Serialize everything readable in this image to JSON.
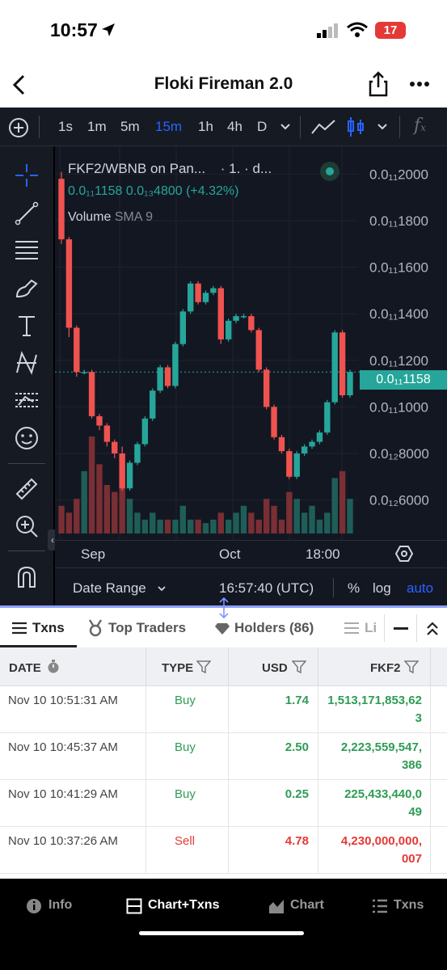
{
  "status": {
    "time": "10:57",
    "battery": "17"
  },
  "nav": {
    "title": "Floki Fireman 2.0"
  },
  "toolbar": {
    "timeframes": [
      "1s",
      "1m",
      "5m",
      "15m",
      "1h",
      "4h",
      "D"
    ],
    "active_timeframe": "15m"
  },
  "chart": {
    "pair": "FKF2/WBNB on Pan...",
    "suffix": "· 1. · d...",
    "price_line": "0.0₁₁1158  0.0₁₃4800 (+4.32%)",
    "volume_label": "Volume",
    "volume_sma": "SMA 9",
    "y_ticks": [
      "0.0₁₁2000",
      "0.0₁₁1800",
      "0.0₁₁1600",
      "0.0₁₁1400",
      "0.0₁₁1200",
      "0.0₁₁1000",
      "0.0₁₂8000",
      "0.0₁₂6000"
    ],
    "last_price_label": "0.0₁₁1158",
    "x_ticks": [
      "Sep",
      "Oct",
      "18:00"
    ],
    "date_range": "Date Range",
    "clock": "16:57:40 (UTC)",
    "pct": "%",
    "log": "log",
    "auto": "auto"
  },
  "chart_data": {
    "type": "candlestick",
    "ylim": [
      5.5,
      20.5
    ],
    "unit_note": "x 1e-12",
    "candles": [
      {
        "o": 19.8,
        "h": 20.1,
        "l": 17.0,
        "c": 17.2
      },
      {
        "o": 17.2,
        "h": 17.3,
        "l": 13.0,
        "c": 13.4
      },
      {
        "o": 13.4,
        "h": 13.5,
        "l": 11.3,
        "c": 11.5
      },
      {
        "o": 11.5,
        "h": 11.6,
        "l": 11.4,
        "c": 11.5
      },
      {
        "o": 11.5,
        "h": 11.6,
        "l": 9.5,
        "c": 9.6
      },
      {
        "o": 9.6,
        "h": 9.7,
        "l": 9.0,
        "c": 9.2
      },
      {
        "o": 9.2,
        "h": 9.3,
        "l": 8.3,
        "c": 8.5
      },
      {
        "o": 8.5,
        "h": 8.6,
        "l": 7.8,
        "c": 8.0
      },
      {
        "o": 8.0,
        "h": 8.3,
        "l": 6.4,
        "c": 6.5
      },
      {
        "o": 6.5,
        "h": 7.7,
        "l": 6.4,
        "c": 7.6
      },
      {
        "o": 7.6,
        "h": 8.5,
        "l": 7.5,
        "c": 8.4
      },
      {
        "o": 8.4,
        "h": 9.6,
        "l": 8.3,
        "c": 9.5
      },
      {
        "o": 9.5,
        "h": 10.8,
        "l": 9.4,
        "c": 10.7
      },
      {
        "o": 10.7,
        "h": 11.8,
        "l": 10.6,
        "c": 11.7
      },
      {
        "o": 11.7,
        "h": 11.8,
        "l": 10.8,
        "c": 10.9
      },
      {
        "o": 10.9,
        "h": 12.8,
        "l": 10.8,
        "c": 12.7
      },
      {
        "o": 12.7,
        "h": 14.2,
        "l": 12.6,
        "c": 14.1
      },
      {
        "o": 14.1,
        "h": 15.4,
        "l": 14.0,
        "c": 15.3
      },
      {
        "o": 15.3,
        "h": 15.4,
        "l": 14.4,
        "c": 14.5
      },
      {
        "o": 14.5,
        "h": 15.0,
        "l": 14.4,
        "c": 14.9
      },
      {
        "o": 14.9,
        "h": 15.2,
        "l": 14.8,
        "c": 15.1
      },
      {
        "o": 15.1,
        "h": 15.2,
        "l": 12.7,
        "c": 12.9
      },
      {
        "o": 12.9,
        "h": 13.8,
        "l": 12.8,
        "c": 13.7
      },
      {
        "o": 13.7,
        "h": 14.0,
        "l": 13.6,
        "c": 13.9
      },
      {
        "o": 13.9,
        "h": 14.0,
        "l": 13.8,
        "c": 13.9
      },
      {
        "o": 13.9,
        "h": 14.0,
        "l": 13.2,
        "c": 13.3
      },
      {
        "o": 13.3,
        "h": 13.4,
        "l": 11.5,
        "c": 11.6
      },
      {
        "o": 11.6,
        "h": 11.7,
        "l": 9.9,
        "c": 10.0
      },
      {
        "o": 10.0,
        "h": 10.1,
        "l": 8.6,
        "c": 8.7
      },
      {
        "o": 8.7,
        "h": 8.8,
        "l": 8.0,
        "c": 8.1
      },
      {
        "o": 8.1,
        "h": 8.2,
        "l": 6.9,
        "c": 7.0
      },
      {
        "o": 7.0,
        "h": 8.1,
        "l": 6.9,
        "c": 8.0
      },
      {
        "o": 8.0,
        "h": 8.4,
        "l": 7.9,
        "c": 8.3
      },
      {
        "o": 8.3,
        "h": 8.6,
        "l": 8.2,
        "c": 8.5
      },
      {
        "o": 8.5,
        "h": 9.0,
        "l": 8.4,
        "c": 8.9
      },
      {
        "o": 8.9,
        "h": 10.3,
        "l": 8.8,
        "c": 10.2
      },
      {
        "o": 10.2,
        "h": 13.3,
        "l": 10.1,
        "c": 13.2
      },
      {
        "o": 13.2,
        "h": 13.3,
        "l": 10.4,
        "c": 10.5
      },
      {
        "o": 10.5,
        "h": 11.6,
        "l": 10.4,
        "c": 11.5
      }
    ],
    "volumes": [
      4,
      3,
      5,
      9,
      14,
      10,
      7,
      6,
      8,
      5,
      3,
      2,
      3,
      2,
      2,
      2,
      4,
      2,
      2,
      1.5,
      2,
      3,
      2,
      3,
      4,
      3,
      2,
      5,
      4,
      2,
      6,
      5,
      3,
      4,
      2,
      3,
      8,
      9,
      5,
      2
    ]
  },
  "tabs": {
    "txns": "Txns",
    "top_traders": "Top Traders",
    "holders": "Holders (86)",
    "liquidity": "Li"
  },
  "table": {
    "headers": {
      "date": "DATE",
      "type": "TYPE",
      "usd": "USD",
      "token": "FKF2"
    },
    "rows": [
      {
        "date": "Nov 10 10:51:31 AM",
        "type": "Buy",
        "usd": "1.74",
        "amount1": "1,513,171,853,62",
        "amount2": "3"
      },
      {
        "date": "Nov 10 10:45:37 AM",
        "type": "Buy",
        "usd": "2.50",
        "amount1": "2,223,559,547,",
        "amount2": "386"
      },
      {
        "date": "Nov 10 10:41:29 AM",
        "type": "Buy",
        "usd": "0.25",
        "amount1": "225,433,440,0",
        "amount2": "49"
      },
      {
        "date": "Nov 10 10:37:26 AM",
        "type": "Sell",
        "usd": "4.78",
        "amount1": "4,230,000,000,",
        "amount2": "007"
      }
    ]
  },
  "bottom_nav": {
    "info": "Info",
    "chart_txns": "Chart+Txns",
    "chart": "Chart",
    "txns": "Txns"
  },
  "colors": {
    "up": "#26a69a",
    "down": "#ef5350",
    "bg": "#131722",
    "accent": "#2962ff",
    "buy": "#2e9c55",
    "sell": "#e53935"
  }
}
